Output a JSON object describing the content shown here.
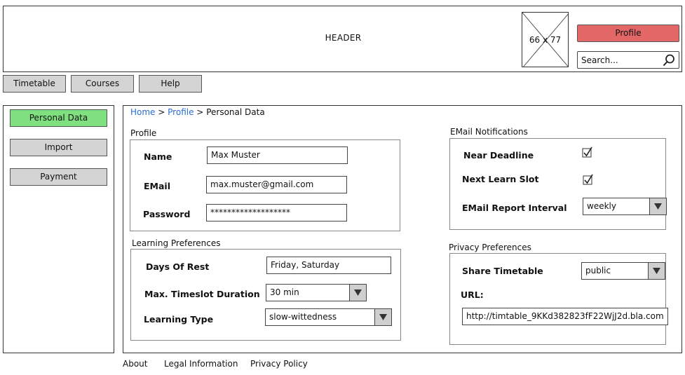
{
  "header": {
    "title": "HEADER",
    "image_placeholder_label": "66 x 77",
    "profile_button": "Profile",
    "search_placeholder": "Search..."
  },
  "nav": {
    "items": [
      "Timetable",
      "Courses",
      "Help"
    ]
  },
  "sidebar": {
    "items": [
      "Personal Data",
      "Import",
      "Payment"
    ],
    "active_color": "#7ee07e"
  },
  "breadcrumb": {
    "home": "Home",
    "profile": "Profile",
    "current": "Personal Data",
    "sep": ">"
  },
  "profile": {
    "title": "Profile",
    "name_label": "Name",
    "name_value": "Max Muster",
    "email_label": "EMail",
    "email_value": "max.muster@gmail.com",
    "password_label": "Password",
    "password_value": "*******************"
  },
  "learning": {
    "title": "Learning Preferences",
    "days_label": "Days Of Rest",
    "days_value": "Friday, Saturday",
    "timeslot_label": "Max. Timeslot Duration",
    "timeslot_value": "30 min",
    "type_label": "Learning Type",
    "type_value": "slow-wittedness"
  },
  "email_notifications": {
    "title": "EMail Notifications",
    "near_deadline_label": "Near Deadline",
    "near_deadline_checked": true,
    "next_slot_label": "Next Learn Slot",
    "next_slot_checked": true,
    "interval_label": "EMail Report Interval",
    "interval_value": "weekly"
  },
  "privacy": {
    "title": "Privacy Preferences",
    "share_label": "Share Timetable",
    "share_value": "public",
    "url_label": "URL:",
    "url_value": "http://timtable_9KKd382823fF22WjJ2d.bla.com"
  },
  "footer": {
    "links": [
      "About",
      "Legal Information",
      "Privacy Policy"
    ]
  },
  "colors": {
    "profile_button": "#e46767",
    "link": "#2a6bd6",
    "button_gray": "#d4d4d4"
  }
}
